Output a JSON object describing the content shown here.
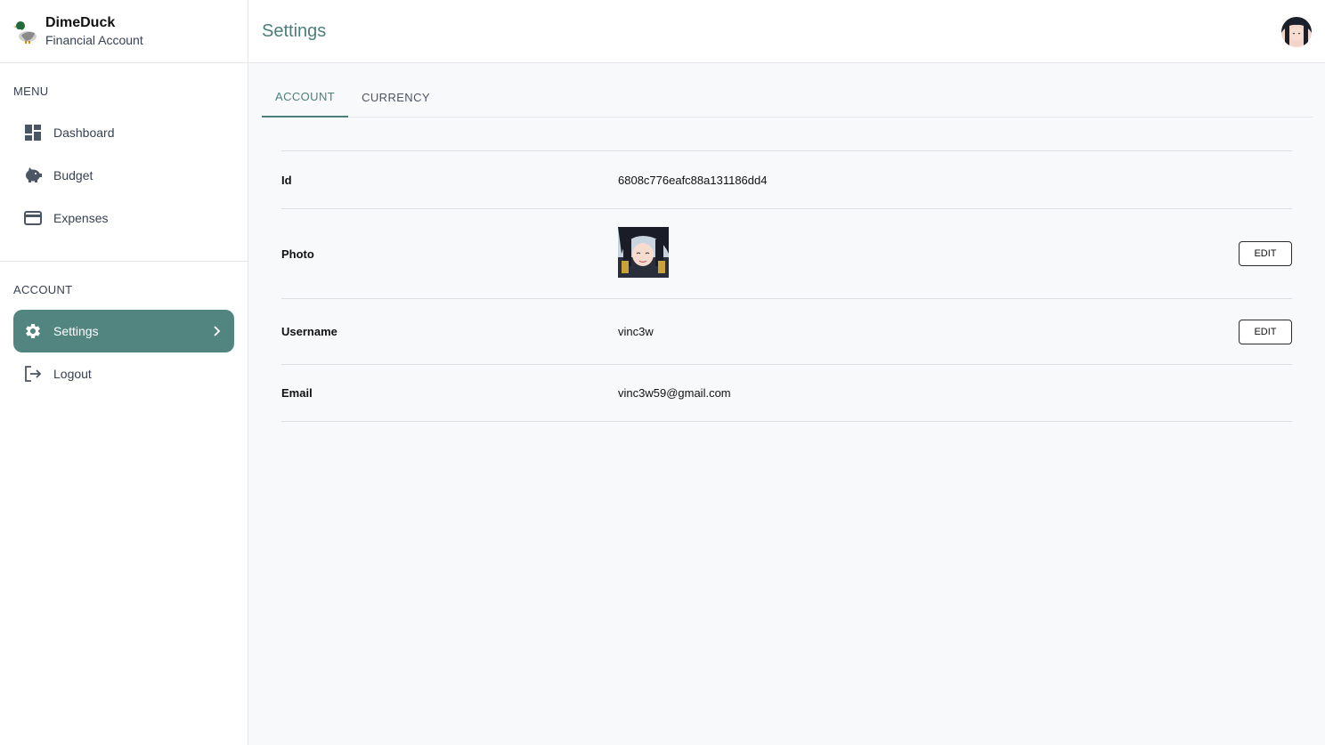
{
  "brand": {
    "name": "DimeDuck",
    "subtitle": "Financial Account",
    "logo_icon": "duck-icon"
  },
  "header": {
    "title": "Settings",
    "avatar_icon": "user-avatar"
  },
  "sidebar": {
    "menu_title": "MENU",
    "menu_items": [
      {
        "label": "Dashboard",
        "icon": "dashboard-icon"
      },
      {
        "label": "Budget",
        "icon": "piggy-bank-icon"
      },
      {
        "label": "Expenses",
        "icon": "credit-card-icon"
      }
    ],
    "account_title": "ACCOUNT",
    "account_items": [
      {
        "label": "Settings",
        "icon": "gear-icon",
        "active": true
      },
      {
        "label": "Logout",
        "icon": "logout-icon"
      }
    ]
  },
  "tabs": [
    {
      "label": "ACCOUNT",
      "active": true
    },
    {
      "label": "CURRENCY",
      "active": false
    }
  ],
  "account": {
    "id_label": "Id",
    "id_value": "6808c776eafc88a131186dd4",
    "photo_label": "Photo",
    "photo_edit": "EDIT",
    "username_label": "Username",
    "username_value": "vinc3w",
    "username_edit": "EDIT",
    "email_label": "Email",
    "email_value": "vinc3w59@gmail.com"
  },
  "colors": {
    "accent": "#52857f",
    "title": "#4d7f7a",
    "background": "#f8f9fb"
  }
}
